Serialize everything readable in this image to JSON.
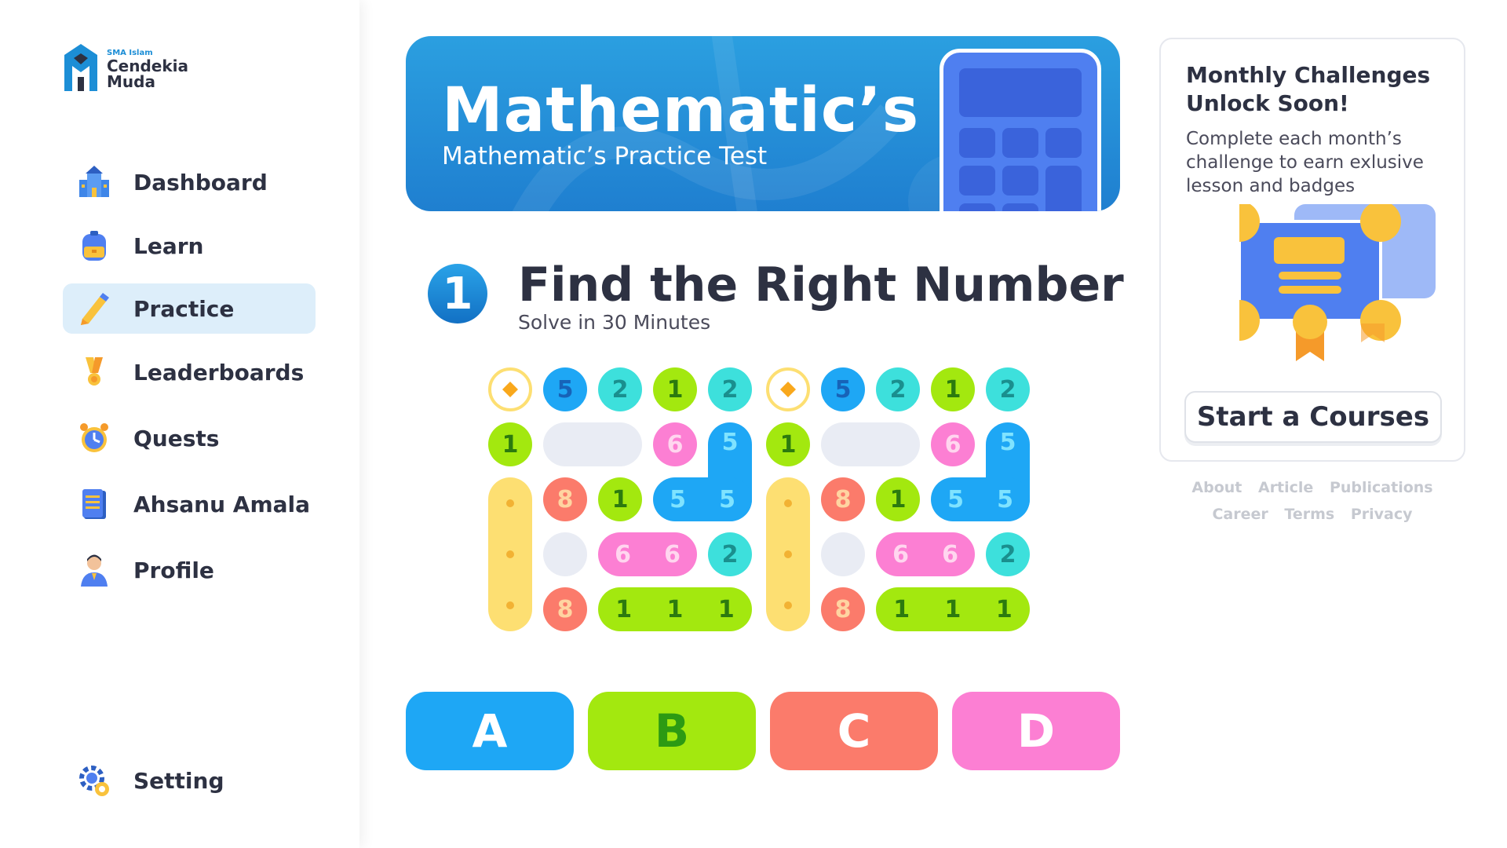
{
  "logo": {
    "small": "SMA Islam",
    "line1": "Cendekia",
    "line2": "Muda"
  },
  "nav": [
    {
      "label": "Dashboard",
      "icon": "school-icon"
    },
    {
      "label": "Learn",
      "icon": "backpack-icon"
    },
    {
      "label": "Practice",
      "icon": "pencil-icon",
      "active": true
    },
    {
      "label": "Leaderboards",
      "icon": "medal-icon"
    },
    {
      "label": "Quests",
      "icon": "alarm-clock-icon"
    },
    {
      "label": "Ahsanu Amala",
      "icon": "notebook-icon"
    },
    {
      "label": "Profile",
      "icon": "person-icon"
    }
  ],
  "setting": {
    "label": "Setting",
    "icon": "gear-icon"
  },
  "banner": {
    "title": "Mathematic’s",
    "subtitle": "Mathematic’s Practice Test"
  },
  "question": {
    "number": "1",
    "title": "Find the Right Number",
    "subtitle": "Solve in 30 Minutes"
  },
  "puzzle": {
    "row1": [
      "5",
      "2",
      "1",
      "2"
    ],
    "row2": [
      "1",
      "6",
      "5"
    ],
    "row3": [
      "8",
      "1",
      "5",
      "5"
    ],
    "row4": [
      "6",
      "6",
      "2"
    ],
    "row5": [
      "8",
      "1",
      "1",
      "1"
    ]
  },
  "answers": [
    {
      "label": "A",
      "color": "#1ea7f5"
    },
    {
      "label": "B",
      "color": "#a3e80f",
      "text_color": "#2c9a13"
    },
    {
      "label": "C",
      "color": "#fb7b6b"
    },
    {
      "label": "D",
      "color": "#fc7fd3"
    }
  ],
  "sidecard": {
    "title": "Monthly Challenges Unlock Soon!",
    "description": "Complete each month’s challenge to earn exlusive lesson and badges",
    "button": "Start a Courses"
  },
  "footer": {
    "line1": [
      "About",
      "Article",
      "Publications"
    ],
    "line2": [
      "Career",
      "Terms",
      "Privacy"
    ]
  },
  "colors": {
    "blue": "#1ea7f5",
    "cyan": "#3de0dc",
    "lime": "#a3e80f",
    "pink": "#fc7fd3",
    "salmon": "#fb7b6b",
    "yellow": "#fddf72",
    "grey": "#e9ecf4",
    "accent": "#1f7fd0"
  }
}
